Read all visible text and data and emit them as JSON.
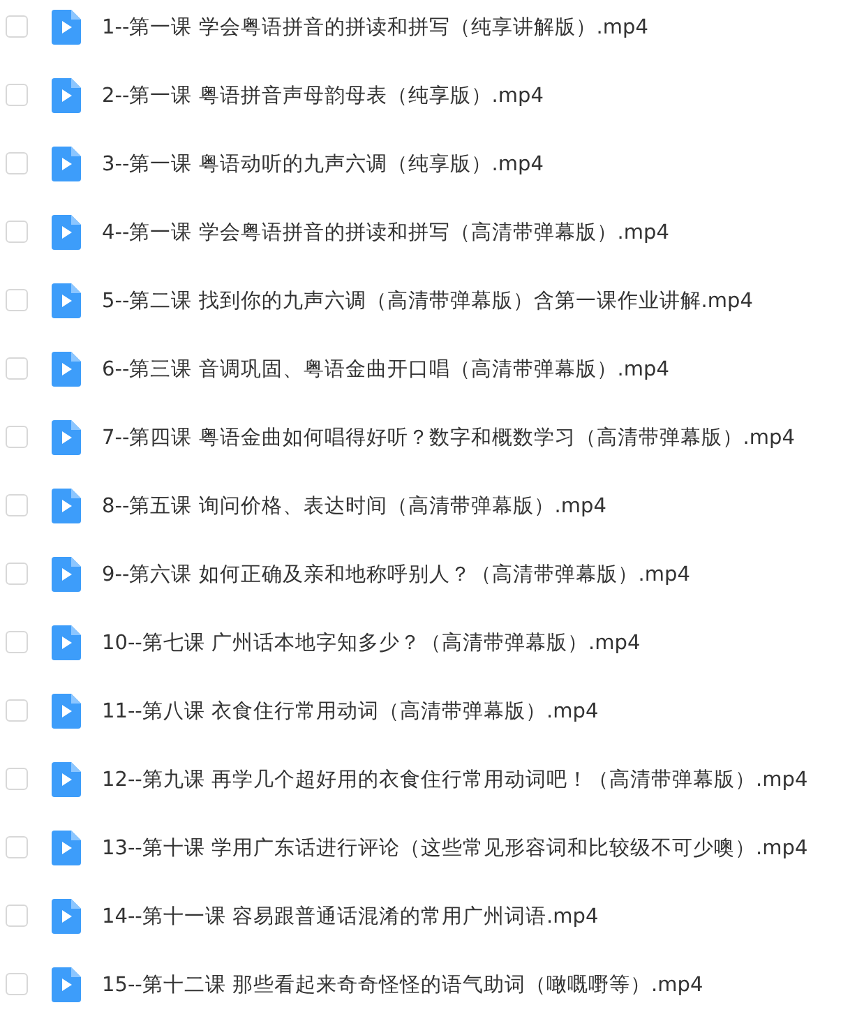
{
  "files": [
    {
      "name": "1--第一课 学会粤语拼音的拼读和拼写（纯享讲解版）.mp4",
      "checked": false
    },
    {
      "name": "2--第一课 粤语拼音声母韵母表（纯享版）.mp4",
      "checked": false
    },
    {
      "name": "3--第一课 粤语动听的九声六调（纯享版）.mp4",
      "checked": false
    },
    {
      "name": "4--第一课 学会粤语拼音的拼读和拼写（高清带弹幕版）.mp4",
      "checked": false
    },
    {
      "name": "5--第二课 找到你的九声六调（高清带弹幕版）含第一课作业讲解.mp4",
      "checked": false
    },
    {
      "name": "6--第三课 音调巩固、粤语金曲开口唱（高清带弹幕版）.mp4",
      "checked": false
    },
    {
      "name": "7--第四课 粤语金曲如何唱得好听？数字和概数学习（高清带弹幕版）.mp4",
      "checked": false
    },
    {
      "name": "8--第五课 询问价格、表达时间（高清带弹幕版）.mp4",
      "checked": false
    },
    {
      "name": "9--第六课 如何正确及亲和地称呼别人？（高清带弹幕版）.mp4",
      "checked": false
    },
    {
      "name": "10--第七课 广州话本地字知多少？（高清带弹幕版）.mp4",
      "checked": false
    },
    {
      "name": "11--第八课 衣食住行常用动词（高清带弹幕版）.mp4",
      "checked": false
    },
    {
      "name": "12--第九课 再学几个超好用的衣食住行常用动词吧！（高清带弹幕版）.mp4",
      "checked": false
    },
    {
      "name": "13--第十课 学用广东话进行评论（这些常见形容词和比较级不可少噢）.mp4",
      "checked": false
    },
    {
      "name": "14--第十一课 容易跟普通话混淆的常用广州词语.mp4",
      "checked": false
    },
    {
      "name": "15--第十二课 那些看起来奇奇怪怪的语气助词（噉嘅嘢等）.mp4",
      "checked": false
    }
  ]
}
